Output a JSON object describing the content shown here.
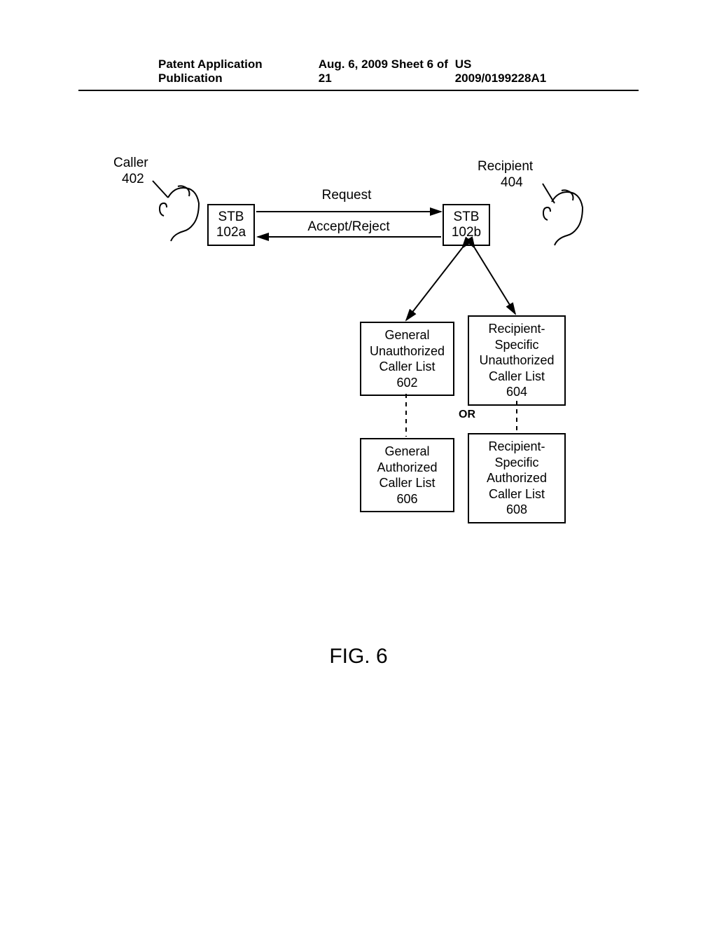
{
  "header": {
    "left": "Patent Application Publication",
    "center": "Aug. 6, 2009  Sheet 6 of 21",
    "right": "US 2009/0199228A1"
  },
  "caller": {
    "label": "Caller",
    "num": "402"
  },
  "recipient": {
    "label": "Recipient",
    "num": "404"
  },
  "stb_left": {
    "line1": "STB",
    "line2": "102a"
  },
  "stb_right": {
    "line1": "STB",
    "line2": "102b"
  },
  "conn": {
    "request": "Request",
    "accept_reject": "Accept/Reject"
  },
  "boxes": {
    "gu": {
      "l1": "General",
      "l2": "Unauthorized",
      "l3": "Caller List",
      "l4": "602"
    },
    "ru": {
      "l1": "Recipient-",
      "l2": "Specific",
      "l3": "Unauthorized",
      "l4": "Caller List",
      "l5": "604"
    },
    "ga": {
      "l1": "General",
      "l2": "Authorized",
      "l3": "Caller List",
      "l4": "606"
    },
    "ra": {
      "l1": "Recipient-",
      "l2": "Specific",
      "l3": "Authorized",
      "l4": "Caller List",
      "l5": "608"
    }
  },
  "or_label": "OR",
  "figure_caption": "FIG. 6"
}
